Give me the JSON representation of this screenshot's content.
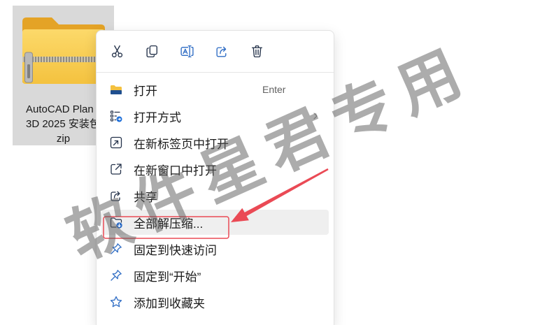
{
  "file": {
    "name_lines": [
      "AutoCAD Plan",
      "3D 2025 安装包",
      "zip"
    ],
    "icon": "zip-folder-icon"
  },
  "menu": {
    "toolbar": [
      {
        "icon": "cut-icon"
      },
      {
        "icon": "copy-icon"
      },
      {
        "icon": "rename-icon"
      },
      {
        "icon": "share-icon"
      },
      {
        "icon": "delete-icon"
      }
    ],
    "items": [
      {
        "label": "打开",
        "icon": "folder-open-icon",
        "shortcut": "Enter"
      },
      {
        "label": "打开方式",
        "icon": "open-with-icon",
        "submenu": true
      },
      {
        "label": "在新标签页中打开",
        "icon": "new-tab-icon"
      },
      {
        "label": "在新窗口中打开",
        "icon": "new-window-icon"
      },
      {
        "label": "共享",
        "icon": "share-icon"
      },
      {
        "label": "全部解压缩...",
        "icon": "extract-all-icon",
        "highlighted": true
      },
      {
        "label": "固定到快速访问",
        "icon": "pin-icon"
      },
      {
        "label": "固定到“开始”",
        "icon": "pin-icon"
      },
      {
        "label": "添加到收藏夹",
        "icon": "star-icon"
      }
    ]
  },
  "watermark": {
    "text": "软件星君专用"
  },
  "colors": {
    "accent": "#2e6cc4",
    "icon_dark": "#24324a",
    "selection_bg": "#d9d9d9",
    "hover_bg": "#efefef",
    "annotation": "#ea4a55",
    "folder_yellow": "#f6c544"
  }
}
